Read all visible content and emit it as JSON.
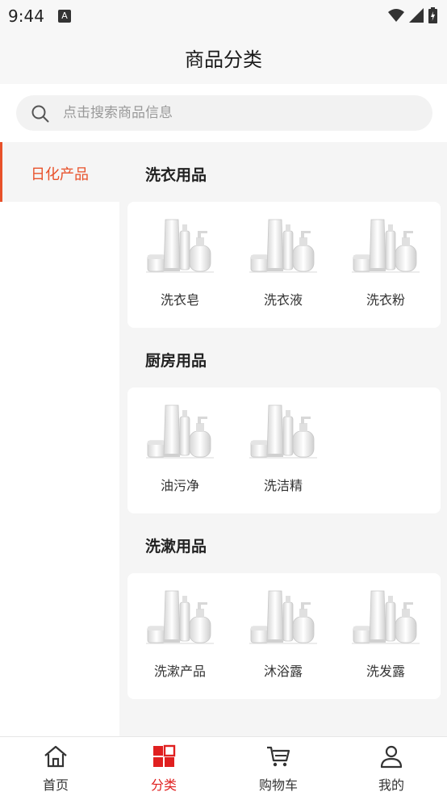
{
  "status_bar": {
    "time": "9:44",
    "notification_icon_letter": "A"
  },
  "header": {
    "title": "商品分类"
  },
  "search": {
    "placeholder": "点击搜索商品信息"
  },
  "sidebar": {
    "items": [
      {
        "label": "日化产品",
        "active": true
      }
    ]
  },
  "sections": [
    {
      "title": "洗衣用品",
      "products": [
        {
          "name": "洗衣皂"
        },
        {
          "name": "洗衣液"
        },
        {
          "name": "洗衣粉"
        }
      ]
    },
    {
      "title": "厨房用品",
      "products": [
        {
          "name": "油污净"
        },
        {
          "name": "洗洁精"
        }
      ]
    },
    {
      "title": "洗漱用品",
      "products": [
        {
          "name": "洗漱产品"
        },
        {
          "name": "沐浴露"
        },
        {
          "name": "洗发露"
        }
      ]
    }
  ],
  "tabbar": {
    "tabs": [
      {
        "label": "首页",
        "icon": "home-icon"
      },
      {
        "label": "分类",
        "icon": "category-icon",
        "active": true
      },
      {
        "label": "购物车",
        "icon": "cart-icon"
      },
      {
        "label": "我的",
        "icon": "user-icon"
      }
    ]
  },
  "colors": {
    "accent": "#e8512a",
    "tab_active": "#e02020",
    "background": "#f5f5f5"
  }
}
